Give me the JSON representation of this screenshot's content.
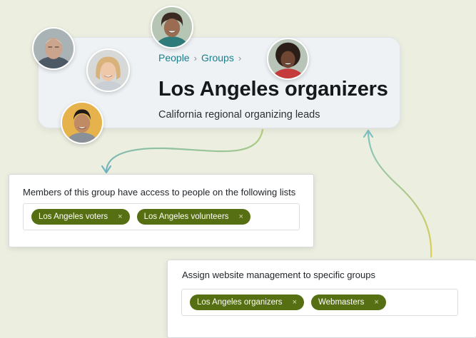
{
  "group_card": {
    "breadcrumb": [
      {
        "label": "People"
      },
      {
        "label": "Groups"
      }
    ],
    "title": "Los Angeles organizers",
    "subtitle": "California regional organizing leads"
  },
  "access_panel": {
    "label": "Members of this group have access to people on the following lists",
    "tags": [
      {
        "label": "Los Angeles voters",
        "remove": "×"
      },
      {
        "label": "Los Angeles volunteers",
        "remove": "×"
      }
    ]
  },
  "website_panel": {
    "label": "Assign website management to specific groups",
    "tags": [
      {
        "label": "Los Angeles organizers",
        "remove": "×"
      },
      {
        "label": "Webmasters",
        "remove": "×"
      }
    ]
  },
  "colors": {
    "background": "#ecefe0",
    "tag_fill": "#566f12",
    "breadcrumb_link": "#1a7f8a",
    "connector_teal": "#6fb4c0",
    "connector_yellow": "#dccb58"
  },
  "avatars": [
    {
      "name": "avatar-older-man"
    },
    {
      "name": "avatar-woman-teal-top"
    },
    {
      "name": "avatar-blonde-woman"
    },
    {
      "name": "avatar-woman-red-top"
    },
    {
      "name": "avatar-man-gray-shirt"
    }
  ]
}
